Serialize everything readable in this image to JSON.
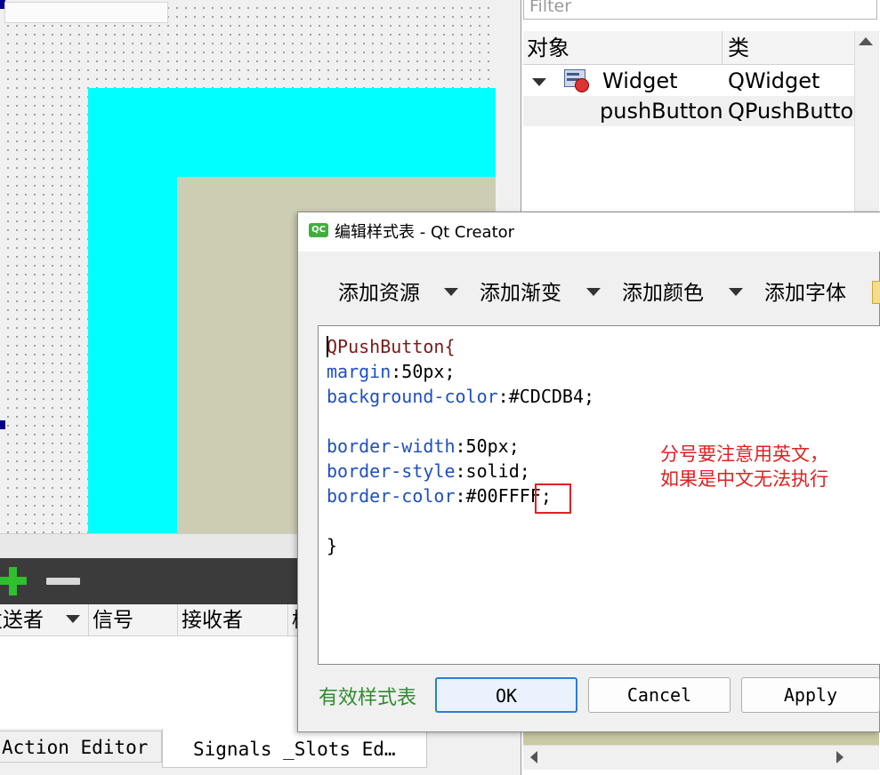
{
  "inspector": {
    "filter_placeholder": "Filter",
    "col_object": "对象",
    "col_class": "类",
    "rows": [
      {
        "object": "Widget",
        "class": "QWidget"
      },
      {
        "object": "pushButton",
        "class": "QPushButton"
      }
    ]
  },
  "signal_slot": {
    "col_sender": "发送者",
    "col_signal": "信号",
    "col_receiver": "接收者",
    "col_slot": "槽"
  },
  "bottom_tabs": {
    "action_editor": "Action Editor",
    "signals_slots": "Signals _Slots Ed…"
  },
  "dialog": {
    "title": "编辑样式表 - Qt Creator",
    "icon_text": "QC",
    "toolbar": [
      "添加资源",
      "添加渐变",
      "添加颜色",
      "添加字体"
    ],
    "code": {
      "selector": "QPushButton{",
      "margin_prop": "margin",
      "margin_val": ":50px;",
      "bg_prop": "background-color",
      "bg_val": ":#CDCDB4;",
      "bw_prop": "border-width",
      "bw_val": ":50px;",
      "bs_prop": "border-style",
      "bs_val": ":solid;",
      "bc_prop": "border-color",
      "bc_val": ":#00FFFF;",
      "close": "}"
    },
    "annotation_line1": "分号要注意用英文，",
    "annotation_line2": "如果是中文无法执行",
    "valid_label": "有效样式表",
    "ok": "OK",
    "cancel": "Cancel",
    "apply": "Apply"
  },
  "colors": {
    "cyan": "#00FFFF",
    "khaki": "#CDCDB4",
    "annotation": "#E02020",
    "valid_green": "#2E8B2E"
  }
}
